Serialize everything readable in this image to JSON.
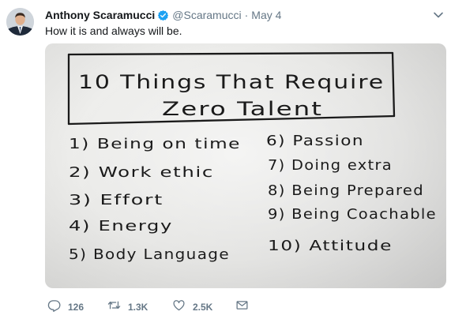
{
  "tweet": {
    "display_name": "Anthony Scaramucci",
    "handle": "@Scaramucci",
    "separator": "·",
    "date": "May 4",
    "text": "How it is and always will be."
  },
  "whiteboard": {
    "title_line1": "10 Things That Require",
    "title_line2": "Zero Talent",
    "left_items": [
      "1) Being on time",
      "2) Work ethic",
      "3) Effort",
      "4) Energy",
      "5) Body Language"
    ],
    "right_items": [
      "6) Passion",
      "7) Doing extra",
      "8) Being Prepared",
      "9) Being Coachable",
      "10) Attitude"
    ]
  },
  "actions": {
    "reply_count": "126",
    "retweet_count": "1.3K",
    "like_count": "2.5K"
  },
  "icons": {
    "verified": "verified-badge-icon",
    "caret": "chevron-down-icon",
    "reply": "reply-icon",
    "retweet": "retweet-icon",
    "like": "heart-icon",
    "dm": "envelope-icon"
  },
  "colors": {
    "text_primary": "#14171a",
    "text_secondary": "#657786",
    "verified_blue": "#1da1f2"
  }
}
